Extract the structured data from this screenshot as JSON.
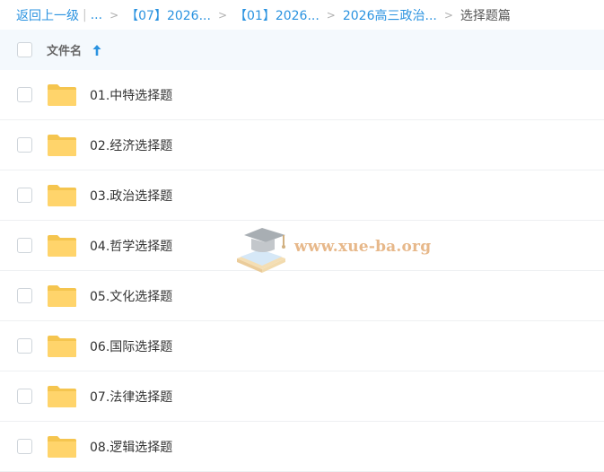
{
  "breadcrumb": {
    "back_label": "返回上一级",
    "pipe": "|",
    "ellipsis": "...",
    "separator": ">",
    "crumbs": [
      "【07】2026...",
      "【01】2026...",
      "2026高三政治..."
    ],
    "current": "选择题篇"
  },
  "table": {
    "header_label": "文件名",
    "sort_direction": "ascending"
  },
  "files": [
    {
      "name": "01.中特选择题",
      "icon": "folder-icon"
    },
    {
      "name": "02.经济选择题",
      "icon": "folder-icon"
    },
    {
      "name": "03.政治选择题",
      "icon": "folder-icon"
    },
    {
      "name": "04.哲学选择题",
      "icon": "folder-icon"
    },
    {
      "name": "05.文化选择题",
      "icon": "folder-icon"
    },
    {
      "name": "06.国际选择题",
      "icon": "folder-icon"
    },
    {
      "name": "07.法律选择题",
      "icon": "folder-icon"
    },
    {
      "name": "08.逻辑选择题",
      "icon": "folder-icon"
    }
  ],
  "watermark": {
    "text": "www.xue-ba.org",
    "icon": "graduation-cap-book-icon"
  },
  "colors": {
    "link": "#2b93e0",
    "header_bg": "#f4f9fd",
    "folder": "#ffd46b",
    "watermark": "#e7b88a"
  }
}
